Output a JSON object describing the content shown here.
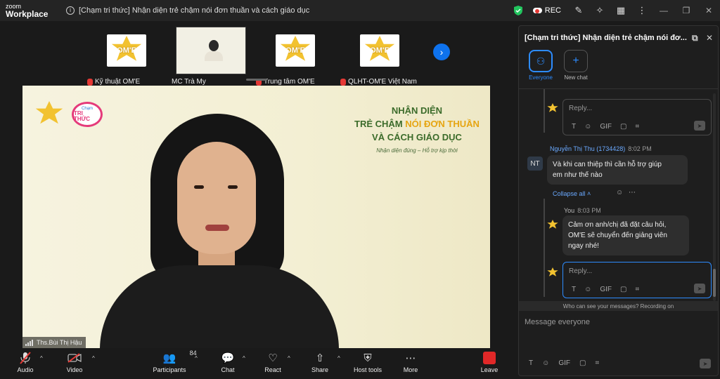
{
  "app": {
    "brand_line1": "zoom",
    "brand_line2": "Workplace",
    "meeting_title": "[Chạm tri thức] Nhận diện trẻ chậm nói đơn thuần và cách giáo dục",
    "rec_label": "REC"
  },
  "thumbnails": [
    {
      "label": "Kỹ thuật OM'E",
      "logo_text": "OM'E"
    },
    {
      "label": "MC Trà My"
    },
    {
      "label": "Trung tâm OM'E",
      "logo_text": "OM'E"
    },
    {
      "label": "QLHT-OM'E Việt Nam",
      "logo_text": "OM'E"
    }
  ],
  "slide": {
    "badge_top": "Chạm",
    "badge_main": "TRI THỨC",
    "line1": "NHẬN DIỆN",
    "line2_a": "TRẺ CHẬM ",
    "line2_b": "NÓI ĐƠN THUẦN",
    "line3": "VÀ CÁCH GIÁO DỤC",
    "line4": "Nhận diện đúng – Hỗ trợ kịp thời",
    "speaker_name": "Ths.Bùi Thị Hậu"
  },
  "toolbar": {
    "audio": "Audio",
    "video": "Video",
    "participants": "Participants",
    "participants_count": "84",
    "chat": "Chat",
    "react": "React",
    "share": "Share",
    "host_tools": "Host tools",
    "more": "More",
    "leave": "Leave"
  },
  "chat": {
    "title": "[Chạm tri thức] Nhận diện trẻ chậm nói đơ...",
    "tab_everyone": "Everyone",
    "tab_new": "New chat",
    "reply_placeholder": "Reply...",
    "msg1": {
      "sender": "Nguyễn Thị Thu (1734428)",
      "time": "8:02 PM",
      "initials": "NT",
      "text_l1": "Và khi can thiệp thì cần hỗ trợ giúp",
      "text_l2": "em như thế nào"
    },
    "collapse": "Collapse all",
    "msg2": {
      "sender": "You",
      "time": "8:03 PM",
      "text_l1": "Cảm ơn anh/chị đã đặt câu hỏi,",
      "text_l2": "OM'E sẽ chuyển đến giảng viên",
      "text_l3": "ngay nhé!"
    },
    "privacy": "Who can see your messages? Recording on",
    "compose_placeholder": "Message everyone",
    "gif": "GIF"
  },
  "colors": {
    "accent": "#2d8cff",
    "leave": "#e02828",
    "slide_green": "#3b6b2a",
    "slide_gold": "#e6a512"
  }
}
